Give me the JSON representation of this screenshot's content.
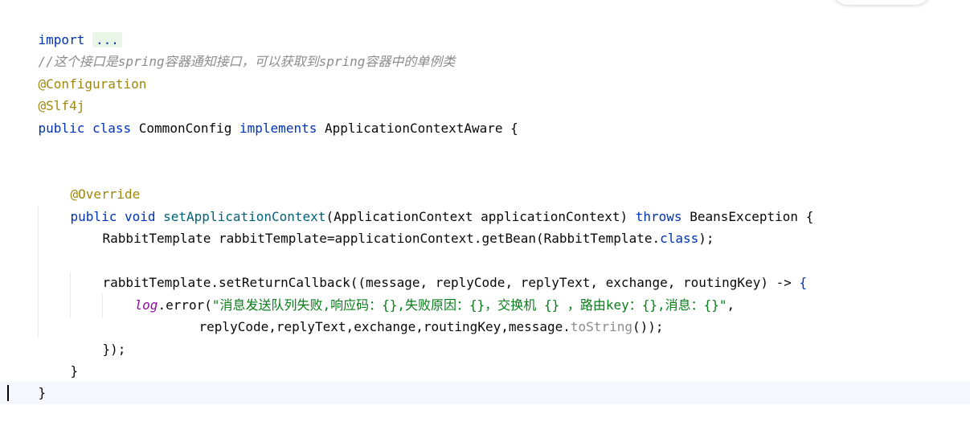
{
  "code": {
    "l1_import": "import",
    "l1_fold": "...",
    "l2_comment": "//这个接口是spring容器通知接口，可以获取到spring容器中的单例类",
    "l3_annotation": "@Configuration",
    "l4_annotation": "@Slf4j",
    "l5_public": "public",
    "l5_class": "class",
    "l5_classname": "CommonConfig",
    "l5_implements": "implements",
    "l5_iface": "ApplicationContextAware {",
    "l8_annotation": "@Override",
    "l9_public": "public",
    "l9_void": "void",
    "l9_method": "setApplicationContext",
    "l9_params": "(ApplicationContext applicationContext)",
    "l9_throws": "throws",
    "l9_exception": "BeansException {",
    "l10_a": "RabbitTemplate rabbitTemplate=applicationContext.getBean(RabbitTemplate.",
    "l10_class": "class",
    "l10_b": ");",
    "l12_a": "rabbitTemplate.setReturnCallback((message, replyCode, replyText, exchange, routingKey) -> ",
    "l12_brace": "{",
    "l13_log": "log",
    "l13_call": ".error(",
    "l13_str": "\"消息发送队列失败,响应码：{},失败原因：{}，交换机 {} ，路由key：{},消息：{}\"",
    "l13_end": ",",
    "l14_a": "replyCode,replyText,exchange,routingKey,message.",
    "l14_tostring": "toString",
    "l14_b": "());",
    "l15": "});",
    "l16": "}",
    "l17": "}"
  },
  "colors": {
    "keyword": "#0033b3",
    "annotation": "#9e880d",
    "comment": "#8c8c8c",
    "string": "#067d17",
    "method": "#00627a",
    "field": "#871094",
    "caret_line": "#f5f8fe"
  }
}
